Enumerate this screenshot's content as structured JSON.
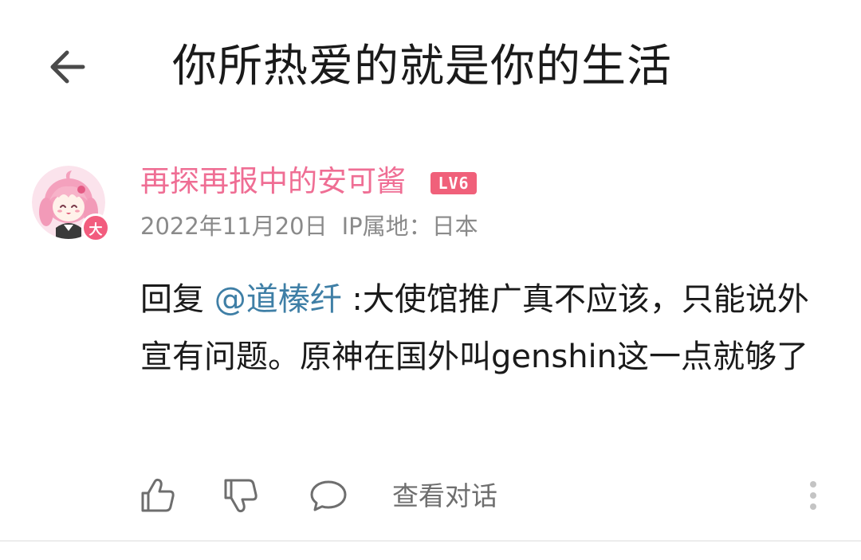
{
  "header": {
    "back_icon": "arrow-left-icon",
    "title": "你所热爱的就是你的生活"
  },
  "comment": {
    "avatar_icon": "anime-girl-avatar",
    "avatar_badge": "大",
    "username": "再探再报中的安可酱",
    "level": "LV6",
    "date": "2022年11月20日",
    "ip_location": "IP属地：日本",
    "reply_prefix": "回复 ",
    "mention": "@道榛纤",
    "text": " :大使馆推广真不应该，只能说外宣有问题。原神在国外叫genshin这一点就够了"
  },
  "actions": {
    "like_icon": "thumbs-up-icon",
    "dislike_icon": "thumbs-down-icon",
    "reply_icon": "speech-bubble-icon",
    "view_conversation": "查看对话",
    "more_icon": "vertical-dots-icon"
  },
  "colors": {
    "title_text": "#1a1a1a",
    "username_pink": "#ef6e94",
    "level_badge_bg": "#f0607a",
    "avatar_badge_bg": "#f25c7e",
    "meta_gray": "#8a8a8a",
    "mention_blue": "#3f7fa6",
    "icon_gray": "#6e6e6e",
    "divider": "#ececec"
  }
}
